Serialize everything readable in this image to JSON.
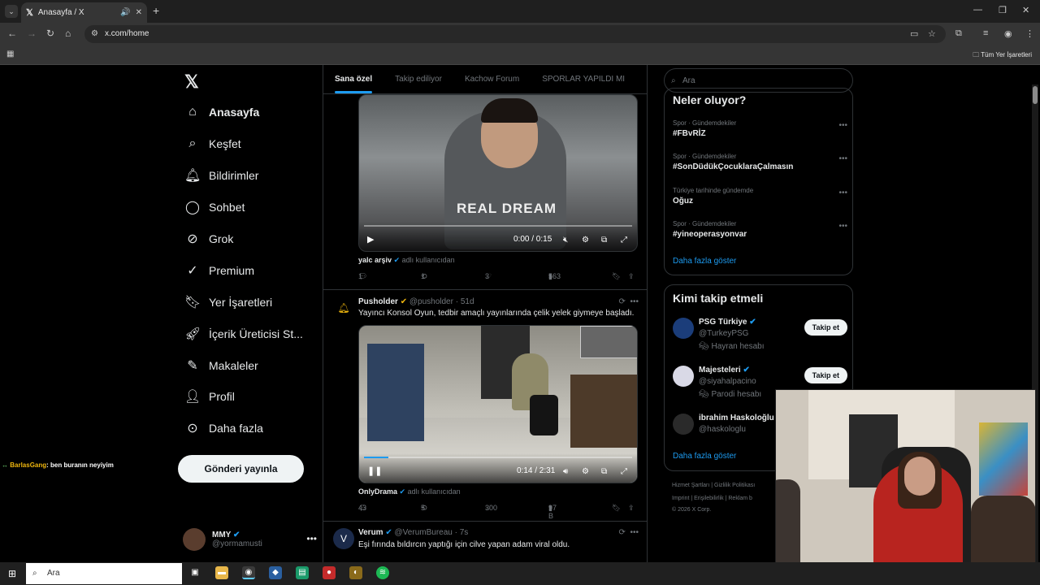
{
  "browser": {
    "tab_title": "Anasayfa / X",
    "url": "x.com/home",
    "bookmarks_all": "Tüm Yer İşaretleri"
  },
  "nav": {
    "items": [
      {
        "label": "Anasayfa",
        "icon": "home-icon"
      },
      {
        "label": "Keşfet",
        "icon": "search-icon"
      },
      {
        "label": "Bildirimler",
        "icon": "bell-icon"
      },
      {
        "label": "Sohbet",
        "icon": "chat-icon"
      },
      {
        "label": "Grok",
        "icon": "grok-icon"
      },
      {
        "label": "Premium",
        "icon": "premium-icon"
      },
      {
        "label": "Yer İşaretleri",
        "icon": "bookmark-icon"
      },
      {
        "label": "İçerik Üreticisi St...",
        "icon": "rocket-icon"
      },
      {
        "label": "Makaleler",
        "icon": "article-icon"
      },
      {
        "label": "Profil",
        "icon": "person-icon"
      },
      {
        "label": "Daha fazla",
        "icon": "more-icon"
      }
    ],
    "post_button": "Gönderi yayınla",
    "account": {
      "name": "MMY",
      "handle": "@yormamusti"
    }
  },
  "chat_overlay": {
    "user": "BarlasGang",
    "message": ": ben buranın neyiyim"
  },
  "feed": {
    "tabs": [
      "Sana özel",
      "Takip ediliyor",
      "Kachow Forum",
      "SPORLAR YAPILDI MI"
    ],
    "video1": {
      "time": "0:00 / 0:15",
      "progress": 0,
      "hoodie_text": "REAL DREAM",
      "source_name": "yalc arşiv",
      "source_suffix": "adlı kullanıcıdan",
      "replies": "1",
      "reposts": "1",
      "likes": "3",
      "views": "563"
    },
    "tweet2": {
      "name": "Pusholder",
      "handle": "@pusholder",
      "time": "· 51d",
      "text": "Yayıncı Konsol Oyun, tedbir amaçlı yayınlarında çelik yelek giymeye başladı.",
      "video_time": "0:14 / 2:31",
      "progress": 0.09,
      "source_name": "OnlyDrama",
      "source_suffix": "adlı kullanıcıdan",
      "replies": "43",
      "reposts": "5",
      "likes": "300",
      "views": "97 B"
    },
    "tweet3": {
      "name": "Verum",
      "handle": "@VerumBureau",
      "time": "· 7s",
      "text": "Eşi fırında bıldırcın yaptığı için cilve yapan adam viral oldu."
    }
  },
  "right": {
    "search_placeholder": "Ara",
    "trends_title": "Neler oluyor?",
    "trends": [
      {
        "category": "Spor · Gündemdekiler",
        "tag": "#FBvRİZ"
      },
      {
        "category": "Spor · Gündemdekiler",
        "tag": "#SonDüdükÇocuklaraÇalmasın"
      },
      {
        "category": "Türkiye tarihinde gündemde",
        "tag": "Oğuz"
      },
      {
        "category": "Spor · Gündemdekiler",
        "tag": "#yineoperasyonvar"
      }
    ],
    "show_more": "Daha fazla göster",
    "who_title": "Kimi takip etmeli",
    "who": [
      {
        "name": "PSG Türkiye",
        "handle": "@TurkeyPSG",
        "badge": "Hayran hesabı",
        "button": "Takip et"
      },
      {
        "name": "Majesteleri",
        "handle": "@siyahalpacino",
        "badge": "Parodi hesabı",
        "button": "Takip et"
      },
      {
        "name": "ibrahim Haskoloğlu",
        "handle": "@haskologlu",
        "badge": "",
        "button": ""
      }
    ],
    "who_show_more": "Daha fazla göster",
    "footer_line1": "Hizmet Şartları  |  Gizlilik Politikası",
    "footer_line2": "Imprint  |  Erişilebilirlik  |  Reklam b",
    "footer_line3": "© 2026 X Corp."
  },
  "taskbar": {
    "search": "Ara"
  }
}
